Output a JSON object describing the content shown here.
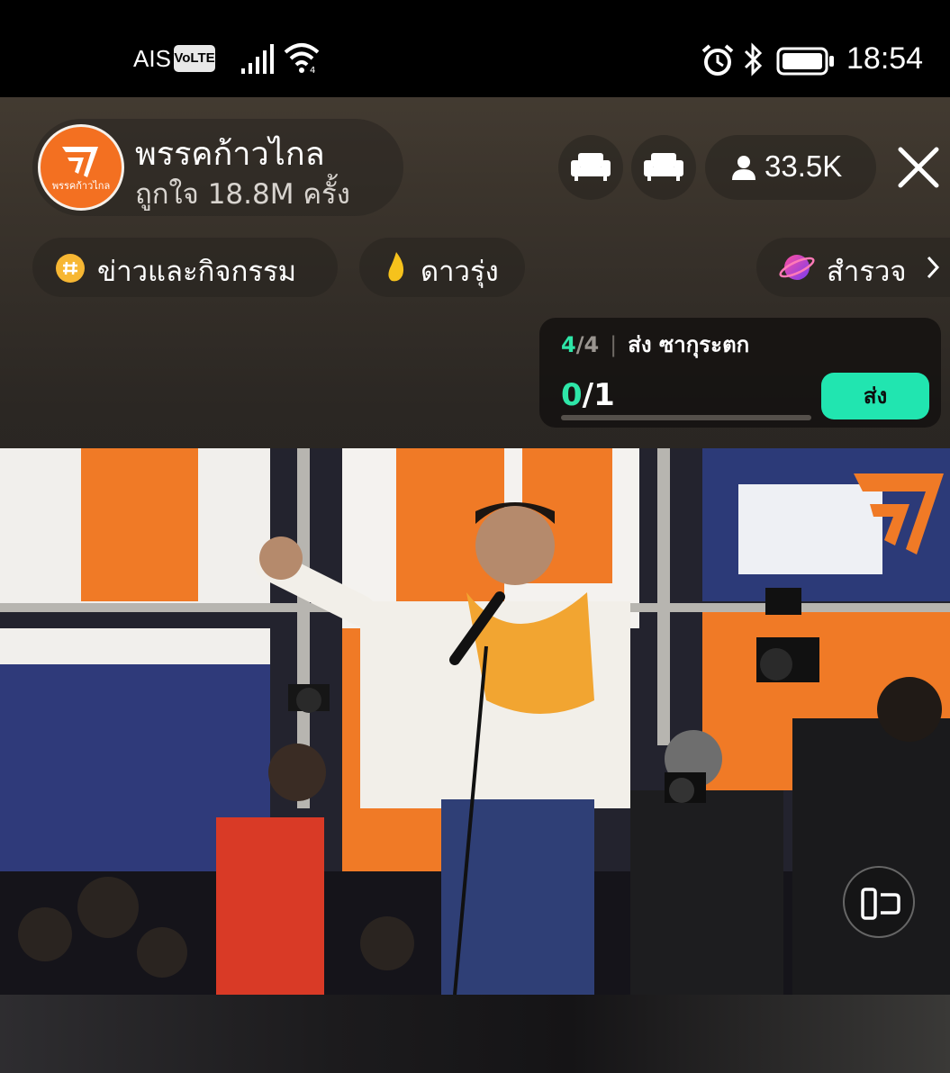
{
  "status_bar": {
    "carrier": "AIS",
    "volte": "VoLTE",
    "time": "18:54",
    "icons": [
      "signal-icon",
      "wifi-icon",
      "alarm-icon",
      "bluetooth-icon",
      "battery-icon"
    ]
  },
  "header": {
    "channel_name": "พรรคก้าวไกล",
    "likes": "ถูกใจ 18.8M ครั้ง",
    "avatar_text": "พรรคก้าวไกล",
    "viewers": "33.5K",
    "accent": "#f37021"
  },
  "tags": {
    "news": "ข่าวและกิจกรรม",
    "rising": "ดาวรุ่ง",
    "explore": "สำรวจ"
  },
  "task": {
    "step_current": "4",
    "step_total": "/4",
    "separator": "|",
    "label": "ส่ง ซากุระตก",
    "progress_current": "0",
    "progress_total": "/1",
    "progress_fraction": 0,
    "send_label": "ส่ง",
    "accent": "#21e5b0"
  }
}
